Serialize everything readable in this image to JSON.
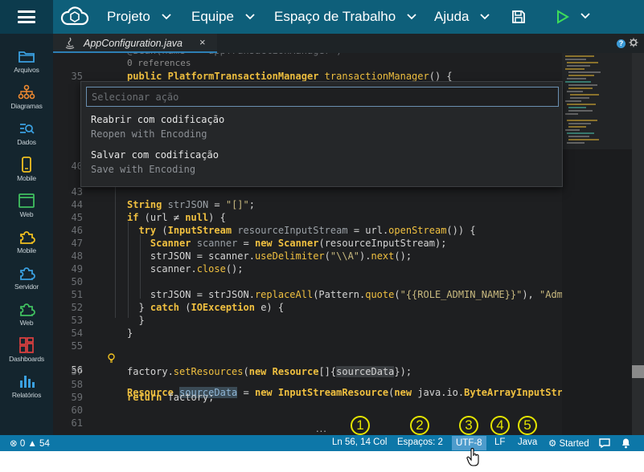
{
  "menu": {
    "items": [
      {
        "label": "Projeto"
      },
      {
        "label": "Equipe"
      },
      {
        "label": "Espaço de Trabalho"
      },
      {
        "label": "Ajuda"
      }
    ]
  },
  "sidebar": {
    "items": [
      {
        "label": "Arquivos",
        "icon": "folder-icon"
      },
      {
        "label": "Diagramas",
        "icon": "diagram-icon"
      },
      {
        "label": "Dados",
        "icon": "data-icon"
      },
      {
        "label": "Mobile",
        "icon": "mobile-icon"
      },
      {
        "label": "Web",
        "icon": "web-icon"
      },
      {
        "label": "Mobile",
        "icon": "puzzle-icon"
      },
      {
        "label": "Servidor",
        "icon": "puzzle-icon"
      },
      {
        "label": "Web",
        "icon": "puzzle-icon"
      },
      {
        "label": "Dashboards",
        "icon": "dashboard-icon"
      },
      {
        "label": "Relatórios",
        "icon": "bar-chart-icon"
      }
    ]
  },
  "tab": {
    "name": "AppConfiguration.java",
    "close": "×"
  },
  "editor": {
    "references": "0 references",
    "lines": {
      "35": "35",
      "40": "40",
      "43": "43",
      "44": "44",
      "45": "45",
      "46": "46",
      "47": "47",
      "48": "48",
      "49": "49",
      "50": "50",
      "51": "51",
      "52": "52",
      "53": "53",
      "54": "54",
      "55": "55",
      "56": "56",
      "57": "57",
      "58": "58",
      "59": "59",
      "60": "60",
      "61": "61"
    }
  },
  "palette": {
    "placeholder": "Selecionar ação",
    "options": [
      {
        "main": "Reabrir com codificação",
        "sub": "Reopen with Encoding"
      },
      {
        "main": "Salvar com codificação",
        "sub": "Save with Encoding"
      }
    ]
  },
  "status": {
    "errors": "0",
    "warnings": "54",
    "position": "Ln 56, 14 Col",
    "spaces": "Espaços: 2",
    "encoding": "UTF-8",
    "eol": "LF",
    "language": "Java",
    "started": "Started"
  },
  "annotations": [
    "1",
    "2",
    "3",
    "4",
    "5"
  ],
  "colors": {
    "accent": "#0d77a8",
    "topbar": "#0e5f7a",
    "sidebar": "#14252e",
    "annotation": "#e4e400"
  }
}
